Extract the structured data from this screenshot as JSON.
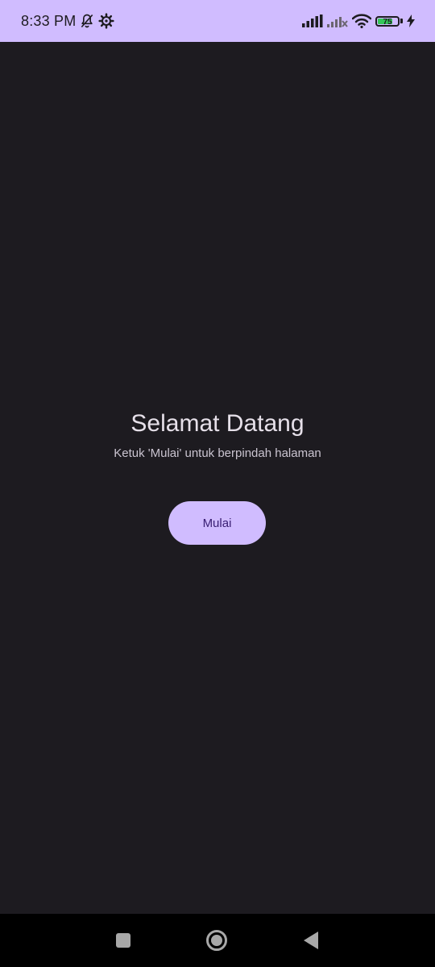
{
  "status_bar": {
    "time": "8:33 PM",
    "icons": [
      "notifications-off-icon",
      "settings-gear-icon",
      "signal-bars-icon",
      "signal-bars-no-service-icon",
      "wifi-icon",
      "battery-icon",
      "charging-bolt-icon"
    ],
    "battery_level": "75",
    "battery_fraction": 0.75,
    "background_color": "#d0bcff"
  },
  "main": {
    "title": "Selamat Datang",
    "subtitle": "Ketuk 'Mulai' untuk berpindah halaman",
    "start_button_label": "Mulai",
    "background_color": "#1d1b20",
    "accent_color": "#d0bcff"
  },
  "nav_bar": {
    "buttons": [
      "recent-apps-icon",
      "home-icon",
      "back-icon"
    ]
  }
}
